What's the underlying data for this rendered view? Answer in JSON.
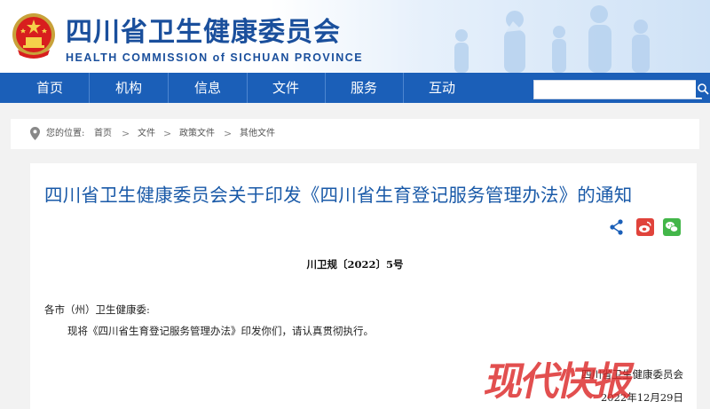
{
  "header": {
    "site_name": "四川省卫生健康委员会",
    "site_name_en": "HEALTH COMMISSION of SICHUAN PROVINCE"
  },
  "nav": {
    "items": [
      "首页",
      "机构",
      "信息",
      "文件",
      "服务",
      "互动"
    ],
    "search_placeholder": ""
  },
  "breadcrumb": {
    "prefix": "您的位置:",
    "items": [
      "首页",
      "文件",
      "政策文件",
      "其他文件"
    ]
  },
  "article": {
    "title": "四川省卫生健康委员会关于印发《四川省生育登记服务管理办法》的通知",
    "doc_number": "川卫规〔2022〕5号",
    "salutation": "各市（州）卫生健康委:",
    "body": "现将《四川省生育登记服务管理办法》印发你们，请认真贯彻执行。",
    "issuer": "四川省卫生健康委员会",
    "date": "2022年12月29日"
  },
  "share": {
    "icons": [
      "share-icon",
      "weibo-icon",
      "wechat-icon"
    ]
  },
  "watermark": "现代快报",
  "colors": {
    "brand_blue": "#1b5fb8",
    "title_blue": "#1a5aa8",
    "weibo_red": "#e0433b",
    "wechat_green": "#43b649"
  }
}
